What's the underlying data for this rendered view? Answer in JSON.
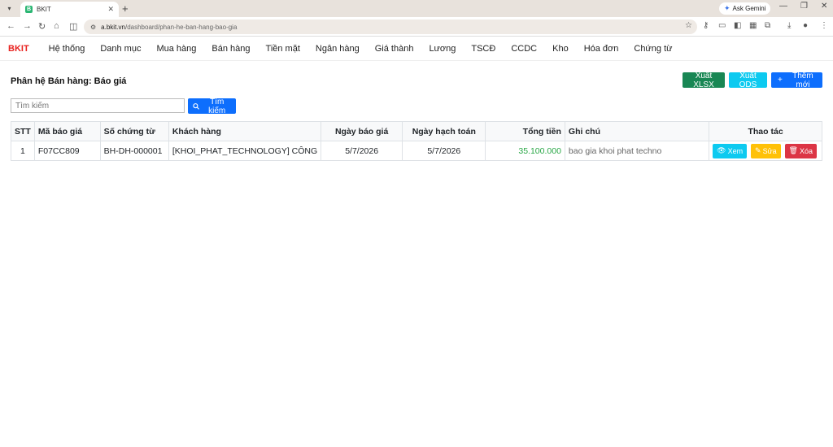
{
  "browser": {
    "tab_title": "BKIT",
    "favicon_letter": "B",
    "url_domain": "a.bkit.vn",
    "url_path": "/dashboard/phan-he-ban-hang-bao-gia",
    "gemini_label": "Ask Gemini"
  },
  "app": {
    "brand": "BKIT",
    "menu": [
      "Hệ thống",
      "Danh mục",
      "Mua hàng",
      "Bán hàng",
      "Tiền mặt",
      "Ngân hàng",
      "Giá thành",
      "Lương",
      "TSCĐ",
      "CCDC",
      "Kho",
      "Hóa đơn",
      "Chứng từ"
    ]
  },
  "page": {
    "title": "Phân hệ Bán hàng: Báo giá",
    "export_xlsx": "Xuất XLSX",
    "export_ods": "Xuất ODS",
    "add_new": "Thêm mới",
    "search_placeholder": "Tìm kiếm",
    "search_button": "Tìm kiếm"
  },
  "table": {
    "headers": [
      "STT",
      "Mã báo giá",
      "Số chứng từ",
      "Khách hàng",
      "Ngày báo giá",
      "Ngày hạch toán",
      "Tổng tiền",
      "Ghi chú",
      "Thao tác"
    ],
    "rows": [
      {
        "stt": "1",
        "code": "F07CC809",
        "doc_no": "BH-DH-000001",
        "customer": "[KHOI_PHAT_TECHNOLOGY] CÔNG",
        "quote_date": "5/7/2026",
        "posting_date": "5/7/2026",
        "total": "35.100.000",
        "note": "bao gia khoi phat techno"
      }
    ],
    "actions": {
      "view": "Xem",
      "edit": "Sửa",
      "delete": "Xóa"
    }
  },
  "colors": {
    "brand": "#e8221f",
    "success": "#198754",
    "info": "#0dcaf0",
    "primary": "#0d6efd",
    "warning": "#ffc107",
    "danger": "#dc3545",
    "amount": "#28a745"
  }
}
